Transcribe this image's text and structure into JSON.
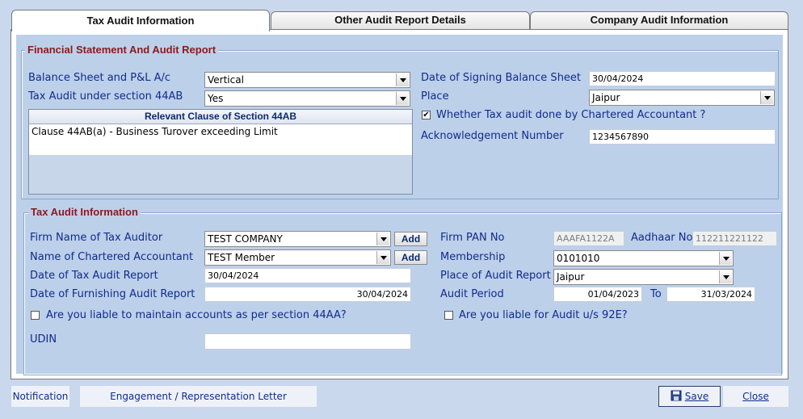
{
  "tabs": [
    {
      "label": "Tax Audit Information"
    },
    {
      "label": "Other Audit Report Details"
    },
    {
      "label": "Company Audit Information"
    }
  ],
  "fin": {
    "title": "Financial Statement And Audit Report",
    "bs_label": "Balance Sheet and P&L A/c",
    "bs_value": "Vertical",
    "ta_label": "Tax Audit  under section 44AB",
    "ta_value": "Yes",
    "clause_header": "Relevant Clause of Section 44AB",
    "clause_row": "Clause 44AB(a) - Business Turover exceeding Limit",
    "sign_label": "Date of Signing Balance Sheet",
    "sign_value": "30/04/2024",
    "place_label": "Place",
    "place_value": "Jaipur",
    "ca_check_label": "Whether Tax audit done by Chartered Accountant ?",
    "ca_checked_mark": "✔",
    "ack_label": "Acknowledgement Number",
    "ack_value": "1234567890"
  },
  "tax": {
    "title": "Tax Audit Information",
    "firm_label": "Firm Name of Tax Auditor",
    "firm_value": "TEST COMPANY",
    "add_label": "Add",
    "ca_label": "Name of Chartered Accountant",
    "ca_value": "TEST Member",
    "date_report_label": "Date of Tax Audit Report",
    "date_report_value": "30/04/2024",
    "date_furnish_label": "Date of Furnishing Audit Report",
    "date_furnish_value": "30/04/2024",
    "liable_44aa_label": "Are you liable to maintain accounts as per section 44AA?",
    "udin_label": "UDIN",
    "udin_value": "",
    "pan_label": "Firm PAN No",
    "pan_value": "AAAFA1122A",
    "aadhaar_label": "Aadhaar No",
    "aadhaar_value": "112211221122",
    "membership_label": "Membership",
    "membership_value": "0101010",
    "place_label": "Place of Audit Report",
    "place_value": "Jaipur",
    "period_label": "Audit Period",
    "period_from": "01/04/2023",
    "to_label": "To",
    "period_to": "31/03/2024",
    "liable_92e_label": "Are you liable for Audit  u/s 92E?"
  },
  "footer": {
    "notification": "Notification",
    "engagement": "Engagement / Representation Letter",
    "save": "Save",
    "close": "Close"
  }
}
